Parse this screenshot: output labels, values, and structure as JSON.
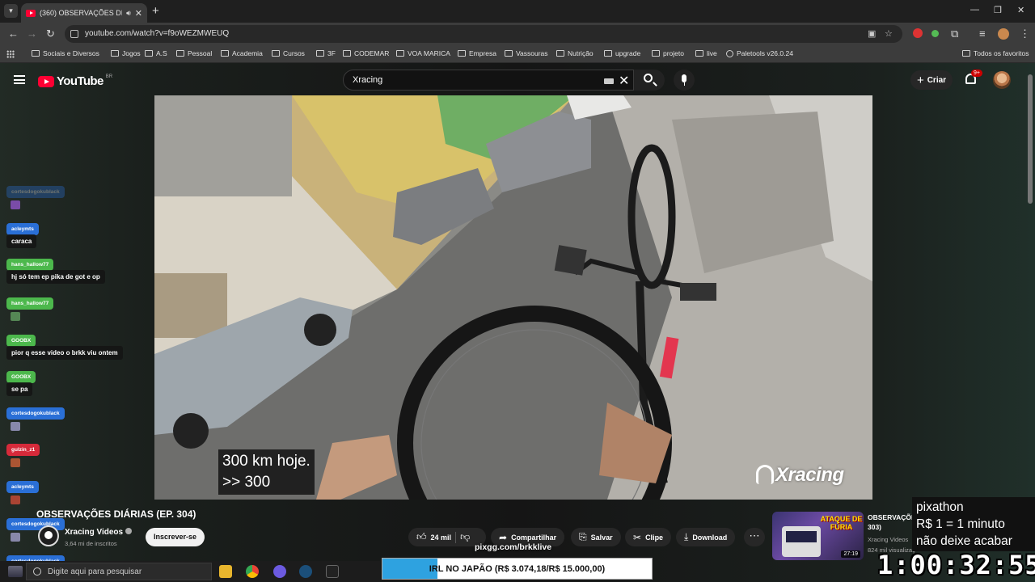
{
  "browser": {
    "tab_title": "(360) OBSERVAÇÕES DIÁRIAS",
    "url": "youtube.com/watch?v=f9oWEZMWEUQ",
    "bookmarks": [
      "Sociais e Diversos",
      "Jogos",
      "A.S",
      "Pessoal",
      "Academia",
      "Cursos",
      "3F",
      "CODEMAR",
      "VOA MARICA",
      "Empresa",
      "Vassouras",
      "Nutrição",
      "upgrade",
      "projeto",
      "live",
      "Paletools v26.0.24"
    ],
    "all_bookmarks": "Todos os favoritos"
  },
  "youtube": {
    "logo_word": "YouTube",
    "country": "BR",
    "search_value": "Xracing",
    "create_label": "Criar",
    "notifications": "9+"
  },
  "video": {
    "subtitle_line1": "300 km hoje.",
    "subtitle_line2": ">> 300",
    "watermark": "Xracing",
    "title": "OBSERVAÇÕES DIÁRIAS (EP. 304)",
    "channel": "Xracing Videos",
    "subscribers": "3,64 mi de inscritos",
    "subscribe_label": "Inscrever-se",
    "likes": "24 mil",
    "share_label": "Compartilhar",
    "save_label": "Salvar",
    "clip_label": "Clipe",
    "download_label": "Download"
  },
  "recommended": {
    "title": "OBSERVAÇÕES 303)",
    "channel": "Xracing Videos",
    "views": "824 mil visualizaç",
    "duration": "27:19",
    "thumb_text": "ATAQUE DE FÚRIA"
  },
  "chat": [
    {
      "user": "cortesdogokublack",
      "color": "#2a6fd6",
      "msg": "",
      "emote": "#7a4ca8"
    },
    {
      "user": "acleymts",
      "color": "#2a6fd6",
      "msg": "caraca",
      "emote": ""
    },
    {
      "user": "hans_hallow77",
      "color": "#4cb84c",
      "msg": "hj só tem ep pika de got e op",
      "emote": ""
    },
    {
      "user": "hans_hallow77",
      "color": "#4cb84c",
      "msg": "",
      "emote": "#558855"
    },
    {
      "user": "GOOBX",
      "color": "#4cb84c",
      "msg": "pior q esse video o brkk viu ontem",
      "emote": ""
    },
    {
      "user": "GOOBX",
      "color": "#4cb84c",
      "msg": "se pa",
      "emote": ""
    },
    {
      "user": "cortesdogokublack",
      "color": "#2a6fd6",
      "msg": "",
      "emote": "#8888aa"
    },
    {
      "user": "gulzin_z1",
      "color": "#d62a3a",
      "msg": "",
      "emote": "#aa5533"
    },
    {
      "user": "acleymts",
      "color": "#2a6fd6",
      "msg": "",
      "emote": "#aa4433"
    },
    {
      "user": "cortesdogokublack",
      "color": "#2a6fd6",
      "msg": "",
      "emote": "#8888aa"
    },
    {
      "user": "cortesdogokublack",
      "color": "#2a6fd6",
      "msg": "",
      "emote": ""
    }
  ],
  "overlay": {
    "pixathon_line1": "pixathon",
    "pixathon_line2": "R$ 1 = 1 minuto",
    "pixathon_line3": "não deixe acabar",
    "timer": "1:00:32:55",
    "pix_url": "pixgg.com/brkklive",
    "goal_text": "IRL NO JAPÃO (R$ 3.074,18/R$ 15.000,00)",
    "goal_progress": 0.205
  },
  "taskbar": {
    "search_placeholder": "Digite aqui para pesquisar"
  }
}
